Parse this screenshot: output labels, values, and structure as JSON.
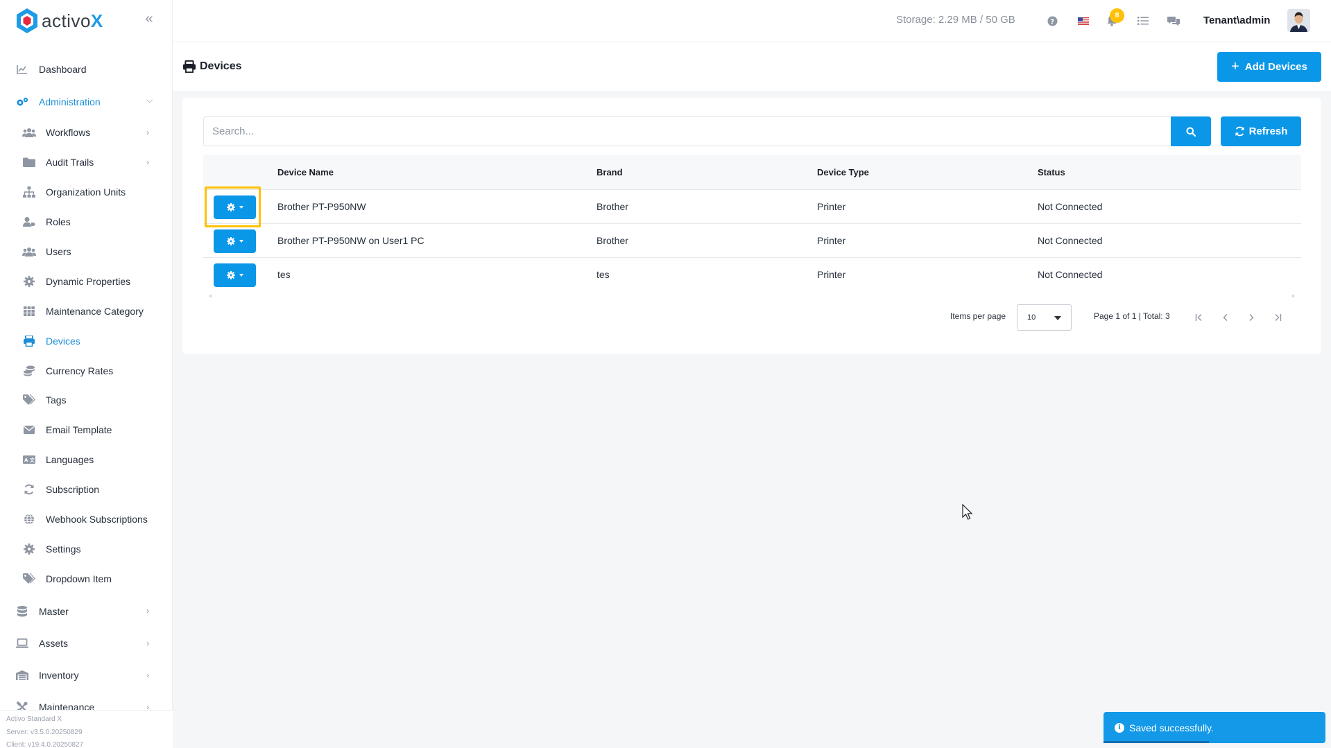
{
  "brand": {
    "name_prefix": "activo",
    "name_suffix": "X"
  },
  "sidebar": {
    "items": [
      {
        "label": "Dashboard",
        "icon": "chart-line-icon"
      },
      {
        "label": "Administration",
        "icon": "cogs-icon",
        "expanded": true
      },
      {
        "label": "Master",
        "icon": "database-icon"
      },
      {
        "label": "Assets",
        "icon": "laptop-icon"
      },
      {
        "label": "Inventory",
        "icon": "warehouse-icon"
      },
      {
        "label": "Maintenance",
        "icon": "tools-icon"
      }
    ],
    "admin_sub": [
      {
        "label": "Workflows",
        "icon": "users-icon",
        "has_children": true
      },
      {
        "label": "Audit Trails",
        "icon": "folder-icon",
        "has_children": true
      },
      {
        "label": "Organization Units",
        "icon": "sitemap-icon"
      },
      {
        "label": "Roles",
        "icon": "user-tag-icon"
      },
      {
        "label": "Users",
        "icon": "users-icon"
      },
      {
        "label": "Dynamic Properties",
        "icon": "cog-icon"
      },
      {
        "label": "Maintenance Category",
        "icon": "grid-icon"
      },
      {
        "label": "Devices",
        "icon": "printer-icon",
        "active": true
      },
      {
        "label": "Currency Rates",
        "icon": "coins-icon"
      },
      {
        "label": "Tags",
        "icon": "tags-icon"
      },
      {
        "label": "Email Template",
        "icon": "envelope-icon"
      },
      {
        "label": "Languages",
        "icon": "language-icon"
      },
      {
        "label": "Subscription",
        "icon": "sync-icon"
      },
      {
        "label": "Webhook Subscriptions",
        "icon": "globe-icon"
      },
      {
        "label": "Settings",
        "icon": "cog-icon"
      },
      {
        "label": "Dropdown Item",
        "icon": "tags-icon"
      }
    ],
    "version": {
      "product": "Activo Standard X",
      "server": "Server: v3.5.0.20250829",
      "client": "Client: v19.4.0.20250827"
    }
  },
  "topbar": {
    "storage": "Storage: 2.29 MB / 50 GB",
    "notification_count": "8",
    "user": "Tenant\\admin"
  },
  "page": {
    "title": "Devices",
    "add_button": "Add Devices",
    "search_placeholder": "Search...",
    "refresh_button": "Refresh"
  },
  "table": {
    "columns": [
      "Device Name",
      "Brand",
      "Device Type",
      "Status"
    ],
    "rows": [
      {
        "name": "Brother PT-P950NW",
        "brand": "Brother",
        "type": "Printer",
        "status": "Not Connected"
      },
      {
        "name": "Brother PT-P950NW on User1 PC",
        "brand": "Brother",
        "type": "Printer",
        "status": "Not Connected"
      },
      {
        "name": "tes",
        "brand": "tes",
        "type": "Printer",
        "status": "Not Connected"
      }
    ]
  },
  "pagination": {
    "items_per_page_label": "Items per page",
    "items_per_page": "10",
    "page_info": "Page 1 of 1 | Total: 3"
  },
  "toast": {
    "message": "Saved successfully."
  },
  "colors": {
    "primary": "#0b97e8",
    "highlight": "#ffc107",
    "active_text": "#1b8ed8"
  }
}
